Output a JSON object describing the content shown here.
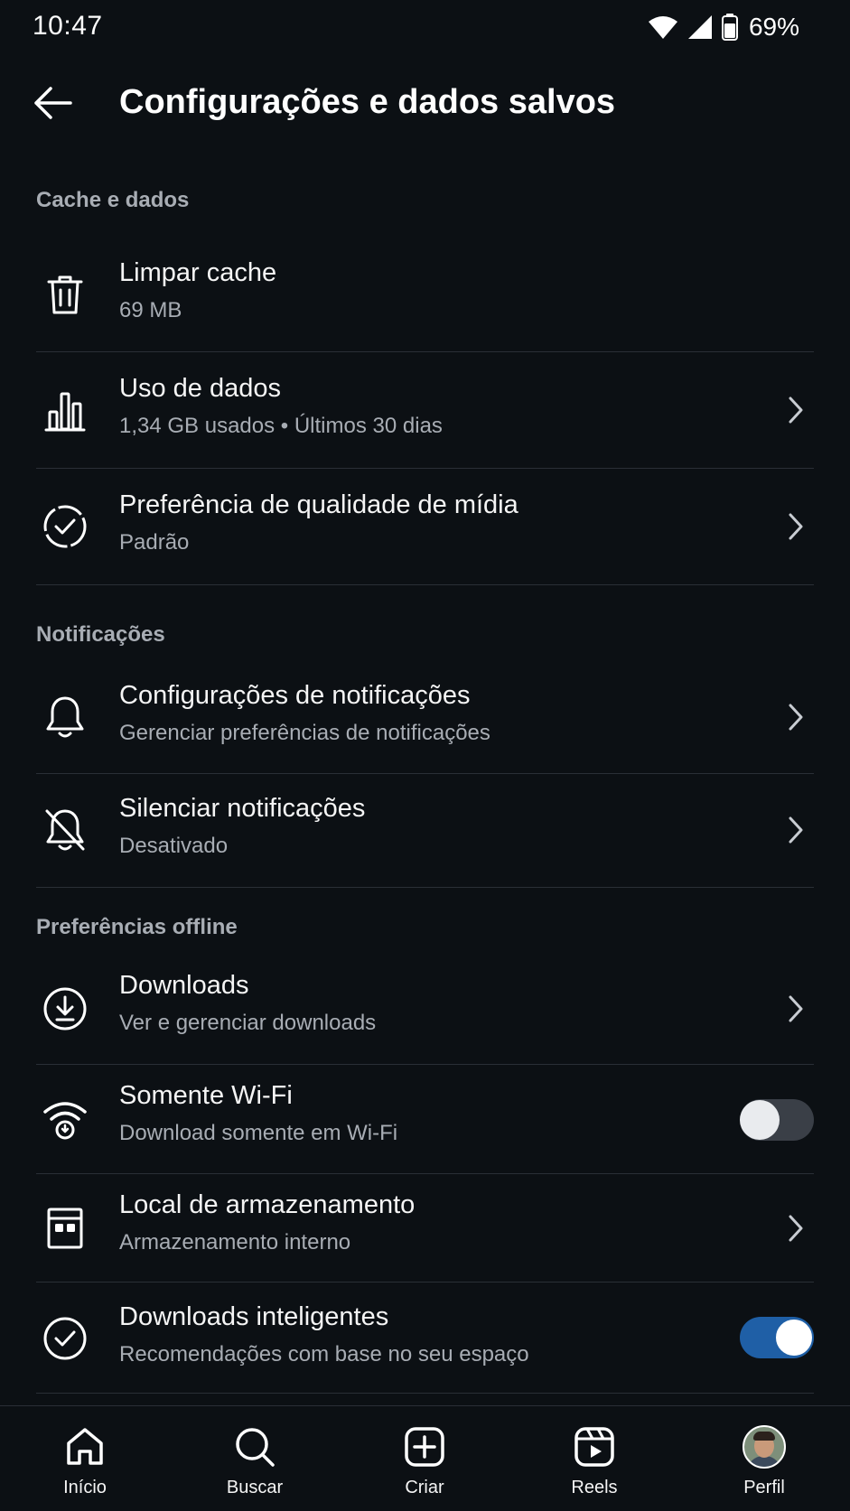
{
  "status_bar": {
    "time": "10:47",
    "battery_percent": "69%",
    "icons": [
      "wifi-icon",
      "cellular-signal-icon",
      "battery-icon"
    ]
  },
  "header": {
    "title": "Configurações e dados salvos",
    "back_icon": "arrow-left-icon"
  },
  "sections": [
    {
      "title": "Cache e dados",
      "items": [
        {
          "title": "Limpar cache",
          "subtitle": "69 MB",
          "icon": "trash-icon",
          "control": "none"
        },
        {
          "title": "Uso de dados",
          "subtitle": "1,34 GB usados • Últimos 30 dias",
          "icon": "bar-chart-icon",
          "control": "chevron"
        },
        {
          "title": "Preferência de qualidade de mídia",
          "subtitle": "Padrão",
          "icon": "check-circle-dashed-icon",
          "control": "chevron"
        }
      ]
    },
    {
      "title": "Notificações",
      "items": [
        {
          "title": "Configurações de notificações",
          "subtitle": "Gerenciar preferências de notificações",
          "icon": "bell-icon",
          "control": "chevron"
        },
        {
          "title": "Silenciar notificações",
          "subtitle": "Desativado",
          "icon": "bell-off-icon",
          "control": "chevron"
        }
      ]
    },
    {
      "title": "Preferências offline",
      "items": [
        {
          "title": "Downloads",
          "subtitle": "Ver e gerenciar downloads",
          "icon": "download-circle-icon",
          "control": "chevron"
        },
        {
          "title": "Somente Wi-Fi",
          "subtitle": "Download somente em Wi-Fi",
          "icon": "wifi-download-icon",
          "control": "toggle",
          "toggle_on": false
        },
        {
          "title": "Local de armazenamento",
          "subtitle": "Armazenamento interno",
          "icon": "sd-card-icon",
          "control": "chevron"
        },
        {
          "title": "Downloads inteligentes",
          "subtitle": "Recomendações com base no seu espaço",
          "icon": "check-circle-icon",
          "control": "toggle",
          "toggle_on": true
        }
      ]
    }
  ],
  "bottom_nav": [
    {
      "label": "Início",
      "icon": "home-icon"
    },
    {
      "label": "Buscar",
      "icon": "search-icon"
    },
    {
      "label": "Criar",
      "icon": "plus-square-icon"
    },
    {
      "label": "Reels",
      "icon": "reels-icon"
    },
    {
      "label": "Perfil",
      "icon": "avatar"
    }
  ],
  "colors": {
    "background": "#0c1014",
    "text_primary": "#f5f5f5",
    "text_secondary": "#a8adb4",
    "divider": "#2a2f36",
    "toggle_on": "#1f5fa6",
    "toggle_off": "#3a3f47"
  }
}
